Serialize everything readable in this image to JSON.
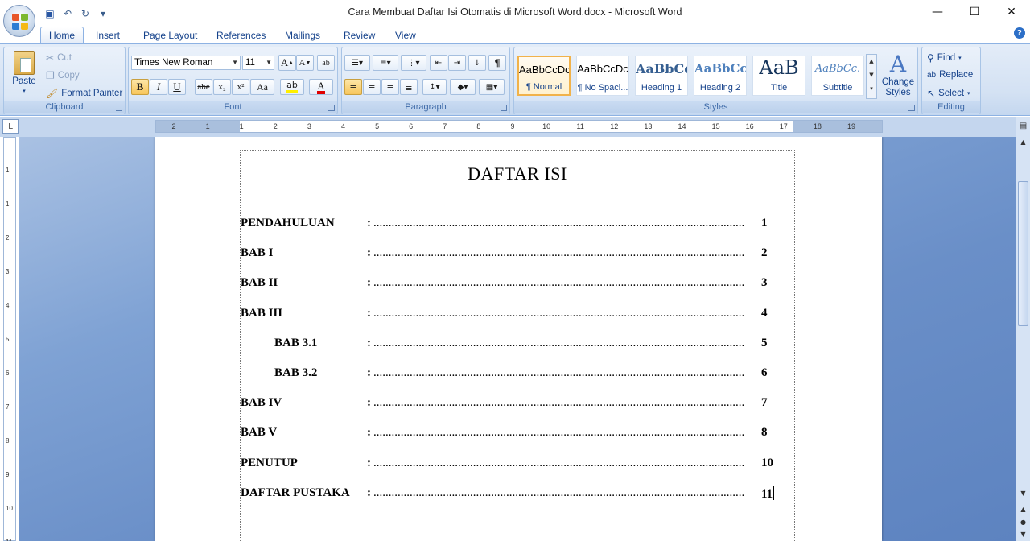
{
  "window": {
    "title": "Cara Membuat Daftar Isi Otomatis di Microsoft Word.docx - Microsoft Word",
    "minimize": "—",
    "maximize": "☐",
    "close": "✕"
  },
  "quick_access": {
    "save_icon": "💾",
    "undo_icon": "↶",
    "redo_icon": "↻",
    "more_icon": "▾"
  },
  "tabs": [
    "Home",
    "Insert",
    "Page Layout",
    "References",
    "Mailings",
    "Review",
    "View"
  ],
  "help": "?",
  "clipboard": {
    "paste": "Paste",
    "cut": "Cut",
    "copy": "Copy",
    "format_painter": "Format Painter",
    "label": "Clipboard"
  },
  "font": {
    "name": "Times New Roman",
    "size": "11",
    "label": "Font",
    "bold": "B",
    "italic": "I",
    "underline": "U",
    "strike": "abe",
    "sub": "x₂",
    "sup": "x²",
    "case": "Aa",
    "grow": "A",
    "shrink": "A"
  },
  "paragraph": {
    "label": "Paragraph"
  },
  "styles": {
    "label": "Styles",
    "items": [
      {
        "sample": "AaBbCcDc",
        "name": "¶ Normal"
      },
      {
        "sample": "AaBbCcDc",
        "name": "¶ No Spaci..."
      },
      {
        "sample": "AaBbCc",
        "name": "Heading 1"
      },
      {
        "sample": "AaBbCc",
        "name": "Heading 2"
      },
      {
        "sample": "AaB",
        "name": "Title"
      },
      {
        "sample": "AaBbCc.",
        "name": "Subtitle"
      }
    ],
    "change_styles": "Change Styles"
  },
  "editing": {
    "find": "Find",
    "replace": "Replace",
    "select": "Select",
    "label": "Editing"
  },
  "ruler": {
    "ticks": [
      "2",
      "1",
      "1",
      "2",
      "3",
      "4",
      "5",
      "6",
      "7",
      "8",
      "9",
      "10",
      "11",
      "12",
      "13",
      "14",
      "15",
      "16",
      "17",
      "18",
      "19"
    ],
    "vticks": [
      "1",
      "1",
      "2",
      "3",
      "4",
      "5",
      "6",
      "7",
      "8",
      "9",
      "10",
      "11"
    ]
  },
  "document": {
    "title": "DAFTAR ISI",
    "toc": [
      {
        "label": "PENDAHULUAN",
        "page": "1",
        "indent": false
      },
      {
        "label": "BAB I",
        "page": "2",
        "indent": false
      },
      {
        "label": "BAB II",
        "page": "3",
        "indent": false
      },
      {
        "label": "BAB III",
        "page": "4",
        "indent": false
      },
      {
        "label": "BAB 3.1",
        "page": "5",
        "indent": true
      },
      {
        "label": "BAB 3.2",
        "page": "6",
        "indent": true
      },
      {
        "label": "BAB IV",
        "page": "7",
        "indent": false
      },
      {
        "label": "BAB V",
        "page": "8",
        "indent": false
      },
      {
        "label": "PENUTUP",
        "page": "10",
        "indent": false
      },
      {
        "label": "DAFTAR PUSTAKA",
        "page": "11",
        "indent": false
      }
    ],
    "colon": ":",
    "leader": ".........................................................................................................................................................................................."
  }
}
